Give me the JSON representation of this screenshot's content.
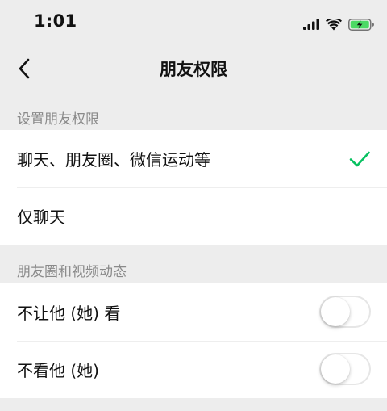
{
  "status_bar": {
    "time": "1:01",
    "icons": [
      "signal-icon",
      "wifi-icon",
      "battery-charging-icon"
    ]
  },
  "nav": {
    "back_icon": "chevron-left-icon",
    "title": "朋友权限"
  },
  "sections": {
    "permission": {
      "header": "设置朋友权限",
      "options": [
        {
          "label": "聊天、朋友圈、微信运动等",
          "selected": true
        },
        {
          "label": "仅聊天",
          "selected": false
        }
      ]
    },
    "moments": {
      "header": "朋友圈和视频动态",
      "toggles": [
        {
          "label": "不让他 (她) 看",
          "on": false
        },
        {
          "label": "不看他 (她)",
          "on": false
        }
      ]
    }
  },
  "colors": {
    "background": "#ededed",
    "accent_check": "#07c160",
    "secondary_text": "#8a8a8a"
  }
}
